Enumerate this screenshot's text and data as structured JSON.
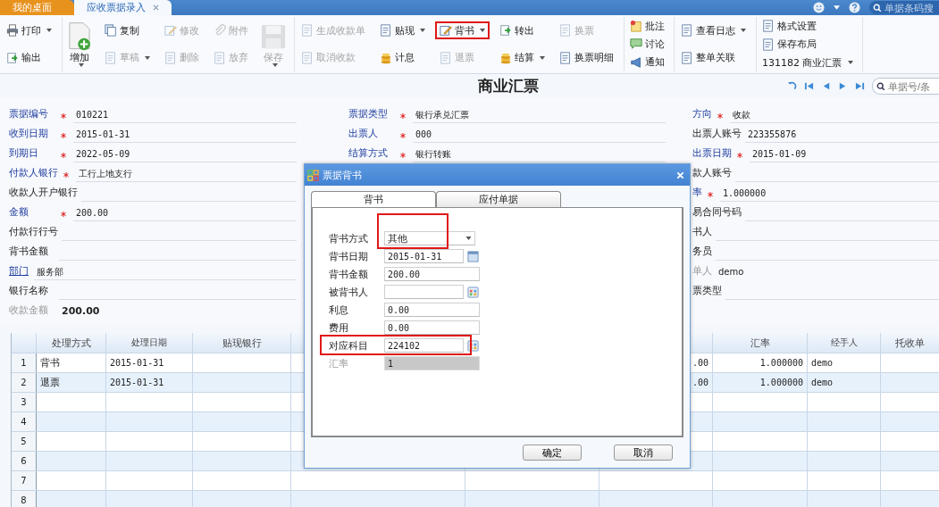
{
  "tabs": [
    {
      "label": "我的桌面",
      "kind": "home",
      "selected": false
    },
    {
      "label": "应收票据录入",
      "kind": "doc",
      "selected": true
    }
  ],
  "top_search": {
    "placeholder": "单据条码搜"
  },
  "toolbar": [
    {
      "columns": [
        [
          {
            "label": "打印",
            "disabled": false,
            "dropdown": true
          },
          {
            "label": "输出",
            "disabled": false,
            "dropdown": false
          }
        ]
      ]
    },
    {
      "columns": [
        [
          {
            "label": "增加",
            "kind": "large",
            "disabled": false,
            "dropdown": true
          }
        ],
        [
          {
            "label": "复制",
            "disabled": false,
            "dropdown": false
          },
          {
            "label": "草稿",
            "disabled": true,
            "dropdown": true
          }
        ],
        [
          {
            "label": "修改",
            "disabled": true,
            "dropdown": false
          },
          {
            "label": "删除",
            "disabled": true,
            "dropdown": false
          }
        ],
        [
          {
            "label": "附件",
            "disabled": true,
            "dropdown": false
          },
          {
            "label": "放弃",
            "disabled": true,
            "dropdown": false
          }
        ],
        [
          {
            "label": "保存",
            "kind": "large",
            "disabled": true,
            "dropdown": true
          }
        ]
      ]
    },
    {
      "columns": [
        [
          {
            "label": "生成收款单",
            "disabled": true,
            "dropdown": false
          },
          {
            "label": "取消收款",
            "disabled": true,
            "dropdown": false
          }
        ],
        [
          {
            "label": "贴现",
            "disabled": false,
            "dropdown": true
          },
          {
            "label": "计息",
            "disabled": false,
            "dropdown": false
          }
        ],
        [
          {
            "label": "背书",
            "disabled": false,
            "dropdown": true,
            "highlighted": true
          },
          {
            "label": "退票",
            "disabled": true,
            "dropdown": false
          }
        ],
        [
          {
            "label": "转出",
            "disabled": false,
            "dropdown": false
          },
          {
            "label": "结算",
            "disabled": false,
            "dropdown": true
          }
        ],
        [
          {
            "label": "换票",
            "disabled": true,
            "dropdown": false
          },
          {
            "label": "换票明细",
            "disabled": false,
            "dropdown": false
          }
        ]
      ]
    },
    {
      "columns": [
        [
          {
            "label": "批注",
            "disabled": false,
            "dropdown": false
          },
          {
            "label": "讨论",
            "disabled": false,
            "dropdown": false
          },
          {
            "label": "通知",
            "disabled": false,
            "dropdown": false
          }
        ]
      ]
    },
    {
      "columns": [
        [
          {
            "label": "查看日志",
            "disabled": false,
            "dropdown": true
          },
          {
            "label": "整单关联",
            "disabled": false,
            "dropdown": false
          }
        ]
      ]
    },
    {
      "columns": [
        [
          {
            "label": "格式设置",
            "disabled": false,
            "dropdown": false
          },
          {
            "label": "保存布局",
            "disabled": false,
            "dropdown": false
          },
          {
            "label": "131182 商业汇票",
            "kind": "text",
            "disabled": false,
            "dropdown": true
          }
        ]
      ]
    }
  ],
  "title": "商业汇票",
  "nav_search": {
    "placeholder": "单据号/条"
  },
  "form": [
    [
      {
        "label": "票据编号",
        "kind": "required",
        "value": "010221"
      },
      {
        "label": "收到日期",
        "kind": "required",
        "value": "2015-01-31"
      },
      {
        "label": "到期日",
        "kind": "required",
        "value": "2022-05-09"
      },
      {
        "label": "付款人银行",
        "kind": "required",
        "value": "工行上地支行"
      },
      {
        "label": "收款人开户银行",
        "kind": "plain"
      },
      {
        "label": "金额",
        "kind": "required",
        "value": "200.00"
      },
      {
        "label": "付款行行号",
        "kind": "plain"
      },
      {
        "label": "背书金额",
        "kind": "plain"
      },
      {
        "label": "部门",
        "kind": "link",
        "value": "服务部"
      },
      {
        "label": "银行名称",
        "kind": "plain"
      },
      {
        "label": "收款金额",
        "kind": "readonly",
        "value": "200.00"
      }
    ],
    [
      {
        "label": "票据类型",
        "kind": "required",
        "value": "银行承兑汇票"
      },
      {
        "label": "出票人",
        "kind": "required",
        "value": "000"
      },
      {
        "label": "结算方式",
        "kind": "required",
        "value": "银行转账"
      }
    ],
    [
      {
        "label": "方向",
        "kind": "required",
        "value": "收款"
      },
      {
        "label": "出票人账号",
        "kind": "plain",
        "value": "223355876"
      },
      {
        "label": "出票日期",
        "kind": "required",
        "value": "2015-01-09"
      },
      {
        "label": "款人账号",
        "kind": "plain"
      },
      {
        "label": "率",
        "kind": "required",
        "value": "1.000000"
      },
      {
        "label": "易合同号码",
        "kind": "plain"
      },
      {
        "label": "书人",
        "kind": "plain"
      },
      {
        "label": "务员",
        "kind": "plain"
      },
      {
        "label": "单人",
        "kind": "readonly",
        "value": "demo"
      },
      {
        "label": "票类型",
        "kind": "plain"
      }
    ]
  ],
  "table": {
    "columns": [
      "处理方式",
      "处理日期",
      "贴现银行",
      "汇率",
      "经手人",
      "托收单"
    ],
    "rows": [
      {
        "number": "1",
        "method": "背书",
        "date": "2015-01-31",
        "column_5": ".00",
        "rate": "1.000000",
        "handler": "demo"
      },
      {
        "number": "2",
        "method": "退票",
        "date": "2015-01-31",
        "column_5": ".00",
        "rate": "1.000000",
        "handler": "demo"
      },
      {
        "number": "3"
      },
      {
        "number": "4"
      },
      {
        "number": "5"
      },
      {
        "number": "6"
      },
      {
        "number": "7"
      },
      {
        "number": "8"
      }
    ]
  },
  "dialog": {
    "title": "票据背书",
    "tabs": [
      {
        "label": "背书",
        "selected": true
      },
      {
        "label": "应付单据",
        "selected": false
      }
    ],
    "fields": [
      {
        "label": "背书方式",
        "kind": "select",
        "value": "其他",
        "highlighted": true
      },
      {
        "label": "背书日期",
        "kind": "date",
        "value": "2015-01-31"
      },
      {
        "label": "背书金额",
        "kind": "text",
        "value": "200.00"
      },
      {
        "label": "被背书人",
        "kind": "lookup"
      },
      {
        "label": "利息",
        "kind": "text",
        "value": "0.00"
      },
      {
        "label": "费用",
        "kind": "text",
        "value": "0.00"
      },
      {
        "label": "对应科目",
        "kind": "lookup",
        "value": "224102",
        "highlighted": true
      },
      {
        "label": "汇率",
        "kind": "readonly",
        "value": "1"
      }
    ],
    "buttons": [
      "确定",
      "取消"
    ]
  }
}
